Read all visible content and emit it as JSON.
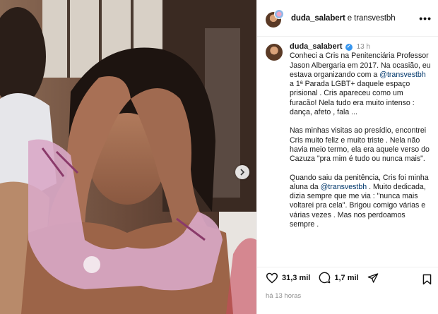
{
  "header": {
    "title_user": "duda_salabert",
    "title_rest": " e transvestbh",
    "more_icon": "more-horizontal-icon"
  },
  "caption": {
    "username": "duda_salabert",
    "verified_icon": "verified-badge-icon",
    "time": "13 h",
    "p1_a": "Conheci a Cris na Penitenciária Professor Jason Albergaria em 2017. Na ocasião, eu estava organizando com a ",
    "p1_mention": "@transvestbh",
    "p1_b": " a 1ª Parada LGBT+ daquele espaço prisional . Cris apareceu como um furacão! Nela tudo era muito intenso : dança, afeto , fala ...",
    "p2": "Nas minhas visitas ao presídio, encontrei Cris muito feliz e muito triste . Nela não havia meio termo, ela era aquele verso do Cazuza \"pra mim é tudo ou nunca mais\".",
    "p3_a": "Quando saiu da penitência, Cris foi minha aluna da ",
    "p3_mention": "@transvestbh",
    "p3_b": " . Muito dedicada, dizia sempre que me via : \"nunca mais voltarei pra cela\". Brigou comigo várias e várias vezes . Mas nos perdoamos sempre ."
  },
  "actions": {
    "likes": "31,3 mil",
    "comments": "1,7 mil",
    "like_icon": "heart-icon",
    "comment_icon": "comment-icon",
    "share_icon": "send-icon",
    "save_icon": "bookmark-icon"
  },
  "timestamp": "há 13 horas",
  "photo": {
    "next_icon": "chevron-right-icon"
  }
}
